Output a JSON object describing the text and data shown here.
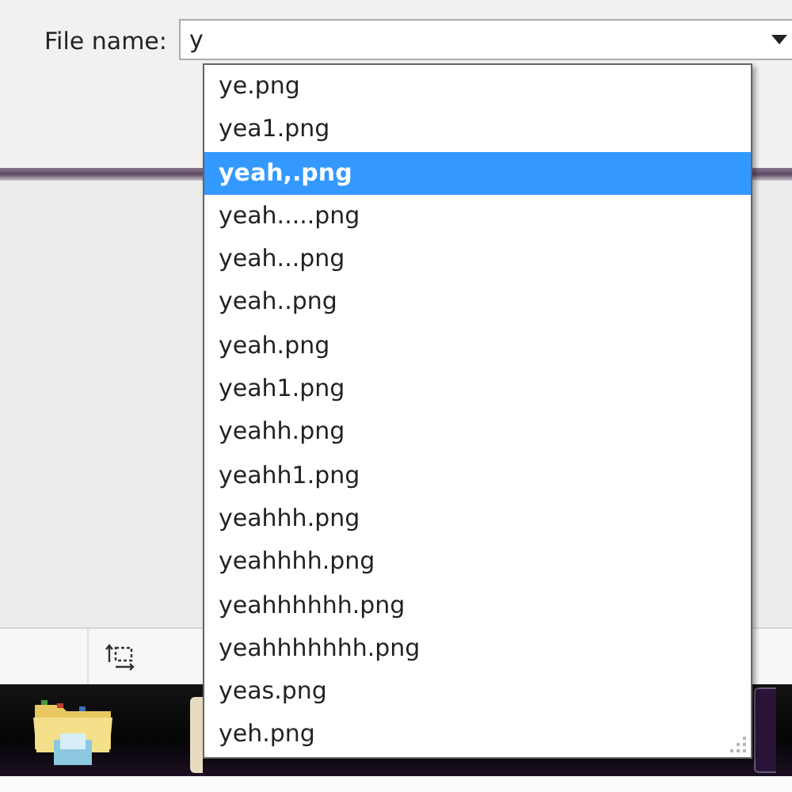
{
  "file_name": {
    "label": "File name:",
    "value": "y"
  },
  "suggestions": [
    {
      "text": "ye.png",
      "selected": false
    },
    {
      "text": "yea1.png",
      "selected": false
    },
    {
      "text": "yeah,.png",
      "selected": true
    },
    {
      "text": "yeah.....png",
      "selected": false
    },
    {
      "text": "yeah...png",
      "selected": false
    },
    {
      "text": "yeah..png",
      "selected": false
    },
    {
      "text": "yeah.png",
      "selected": false
    },
    {
      "text": "yeah1.png",
      "selected": false
    },
    {
      "text": "yeahh.png",
      "selected": false
    },
    {
      "text": "yeahh1.png",
      "selected": false
    },
    {
      "text": "yeahhh.png",
      "selected": false
    },
    {
      "text": "yeahhhh.png",
      "selected": false
    },
    {
      "text": "yeahhhhhh.png",
      "selected": false
    },
    {
      "text": "yeahhhhhhh.png",
      "selected": false
    },
    {
      "text": "yeas.png",
      "selected": false
    },
    {
      "text": "yeh.png",
      "selected": false
    }
  ]
}
